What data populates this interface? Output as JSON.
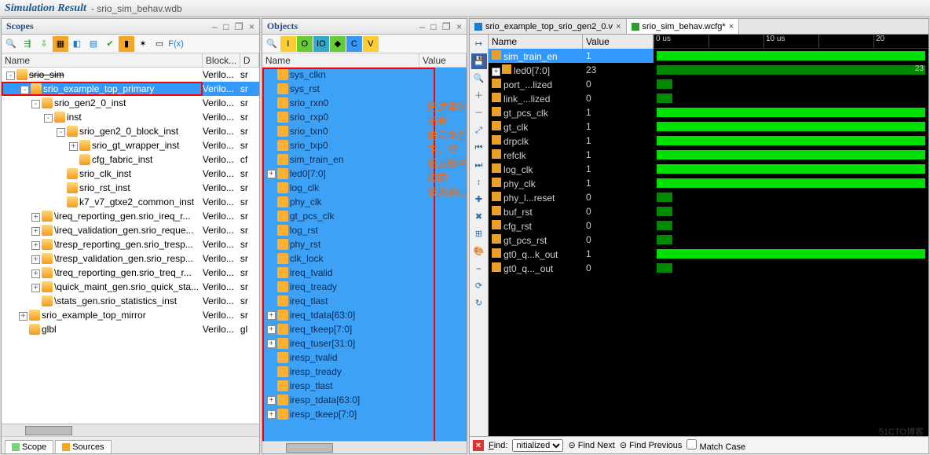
{
  "title": {
    "main": "Simulation Result",
    "sub": "- srio_sim_behav.wdb"
  },
  "scopes": {
    "title": "Scopes",
    "cols": [
      "Name",
      "Block...",
      "D"
    ],
    "tree": [
      {
        "d": 0,
        "tw": "-",
        "ico": "o",
        "name": "srio_sim",
        "b": "Verilo...",
        "c": "sr",
        "sel": false,
        "strike": true
      },
      {
        "d": 1,
        "tw": "-",
        "ico": "o",
        "name": "srio_example_top_primary",
        "b": "Verilo...",
        "c": "sr",
        "sel": true,
        "red": true
      },
      {
        "d": 2,
        "tw": "-",
        "ico": "o",
        "name": "srio_gen2_0_inst",
        "b": "Verilo...",
        "c": "sr"
      },
      {
        "d": 3,
        "tw": "-",
        "ico": "o",
        "name": "inst",
        "b": "Verilo...",
        "c": "sr"
      },
      {
        "d": 4,
        "tw": "-",
        "ico": "o",
        "name": "srio_gen2_0_block_inst",
        "b": "Verilo...",
        "c": "sr"
      },
      {
        "d": 5,
        "tw": "+",
        "ico": "o",
        "name": "srio_gt_wrapper_inst",
        "b": "Verilo...",
        "c": "sr"
      },
      {
        "d": 5,
        "tw": "",
        "ico": "o",
        "name": "cfg_fabric_inst",
        "b": "Verilo...",
        "c": "cf"
      },
      {
        "d": 4,
        "tw": "",
        "ico": "o",
        "name": "srio_clk_inst",
        "b": "Verilo...",
        "c": "sr"
      },
      {
        "d": 4,
        "tw": "",
        "ico": "o",
        "name": "srio_rst_inst",
        "b": "Verilo...",
        "c": "sr"
      },
      {
        "d": 4,
        "tw": "",
        "ico": "o",
        "name": "k7_v7_gtxe2_common_inst",
        "b": "Verilo...",
        "c": "sr"
      },
      {
        "d": 2,
        "tw": "+",
        "ico": "o",
        "name": "\\ireq_reporting_gen.srio_ireq_r...",
        "b": "Verilo...",
        "c": "sr"
      },
      {
        "d": 2,
        "tw": "+",
        "ico": "o",
        "name": "\\ireq_validation_gen.srio_reque...",
        "b": "Verilo...",
        "c": "sr"
      },
      {
        "d": 2,
        "tw": "+",
        "ico": "o",
        "name": "\\tresp_reporting_gen.srio_tresp...",
        "b": "Verilo...",
        "c": "sr"
      },
      {
        "d": 2,
        "tw": "+",
        "ico": "o",
        "name": "\\tresp_validation_gen.srio_resp...",
        "b": "Verilo...",
        "c": "sr"
      },
      {
        "d": 2,
        "tw": "+",
        "ico": "o",
        "name": "\\treq_reporting_gen.srio_treq_r...",
        "b": "Verilo...",
        "c": "sr"
      },
      {
        "d": 2,
        "tw": "+",
        "ico": "o",
        "name": "\\quick_maint_gen.srio_quick_sta...",
        "b": "Verilo...",
        "c": "sr"
      },
      {
        "d": 2,
        "tw": "",
        "ico": "o",
        "name": "\\stats_gen.srio_statistics_inst",
        "b": "Verilo...",
        "c": "sr"
      },
      {
        "d": 1,
        "tw": "+",
        "ico": "o",
        "name": "srio_example_top_mirror",
        "b": "Verilo...",
        "c": "sr"
      },
      {
        "d": 1,
        "tw": "",
        "ico": "o",
        "name": "glbl",
        "b": "Verilo...",
        "c": "gl"
      }
    ],
    "tabs": [
      {
        "label": "Scope",
        "ico": "#7bd07b"
      },
      {
        "label": "Sources",
        "ico": "#f5a623"
      }
    ]
  },
  "objects": {
    "title": "Objects",
    "cols": [
      "Name",
      "Value"
    ],
    "rows": [
      "sys_clkn",
      "sys_rst",
      "srio_rxn0",
      "srio_rxp0",
      "srio_txn0",
      "srio_txp0",
      "sim_train_en",
      "led0[7:0]",
      "log_clk",
      "phy_clk",
      "gt_pcs_clk",
      "log_rst",
      "phy_rst",
      "clk_lock",
      "ireq_tvalid",
      "ireq_tready",
      "ireq_tlast",
      "ireq_tdata[63:0]",
      "ireq_tkeep[7:0]",
      "ireq_tuser[31:0]",
      "iresp_tvalid",
      "iresp_tready",
      "iresp_tlast",
      "iresp_tdata[63:0]",
      "iresp_tkeep[7:0]"
    ],
    "annotation": "把这里列出的所有\n信号全部选中，然\n后直接拖到右边的\n波形窗口"
  },
  "wave": {
    "tabs": [
      {
        "label": "srio_example_top_srio_gen2_0.v",
        "ico": "#1a7dd0"
      },
      {
        "label": "srio_sim_behav.wcfg*",
        "ico": "#2aa02a",
        "active": true
      }
    ],
    "sigcols": [
      "Name",
      "Value"
    ],
    "signals": [
      {
        "n": "sim_train_en",
        "v": "1",
        "sel": true
      },
      {
        "n": "led0[7:0]",
        "v": "23",
        "bus": true
      },
      {
        "n": "port_...lized",
        "v": "0"
      },
      {
        "n": "link_...lized",
        "v": "0"
      },
      {
        "n": "gt_pcs_clk",
        "v": "1"
      },
      {
        "n": "gt_clk",
        "v": "1"
      },
      {
        "n": "drpclk",
        "v": "1"
      },
      {
        "n": "refclk",
        "v": "1"
      },
      {
        "n": "log_clk",
        "v": "1"
      },
      {
        "n": "phy_clk",
        "v": "1"
      },
      {
        "n": "phy_l...reset",
        "v": "0"
      },
      {
        "n": "buf_rst",
        "v": "0"
      },
      {
        "n": "cfg_rst",
        "v": "0"
      },
      {
        "n": "gt_pcs_rst",
        "v": "0"
      },
      {
        "n": "gt0_q...k_out",
        "v": "1"
      },
      {
        "n": "gt0_q..._out",
        "v": "0"
      }
    ],
    "ruler": [
      "0 us",
      "",
      "10 us",
      "",
      "20"
    ],
    "find": {
      "label": "Find:",
      "sel": "nitialized",
      "next": "Find Next",
      "prev": "Find Previous",
      "match": "Match Case"
    }
  }
}
